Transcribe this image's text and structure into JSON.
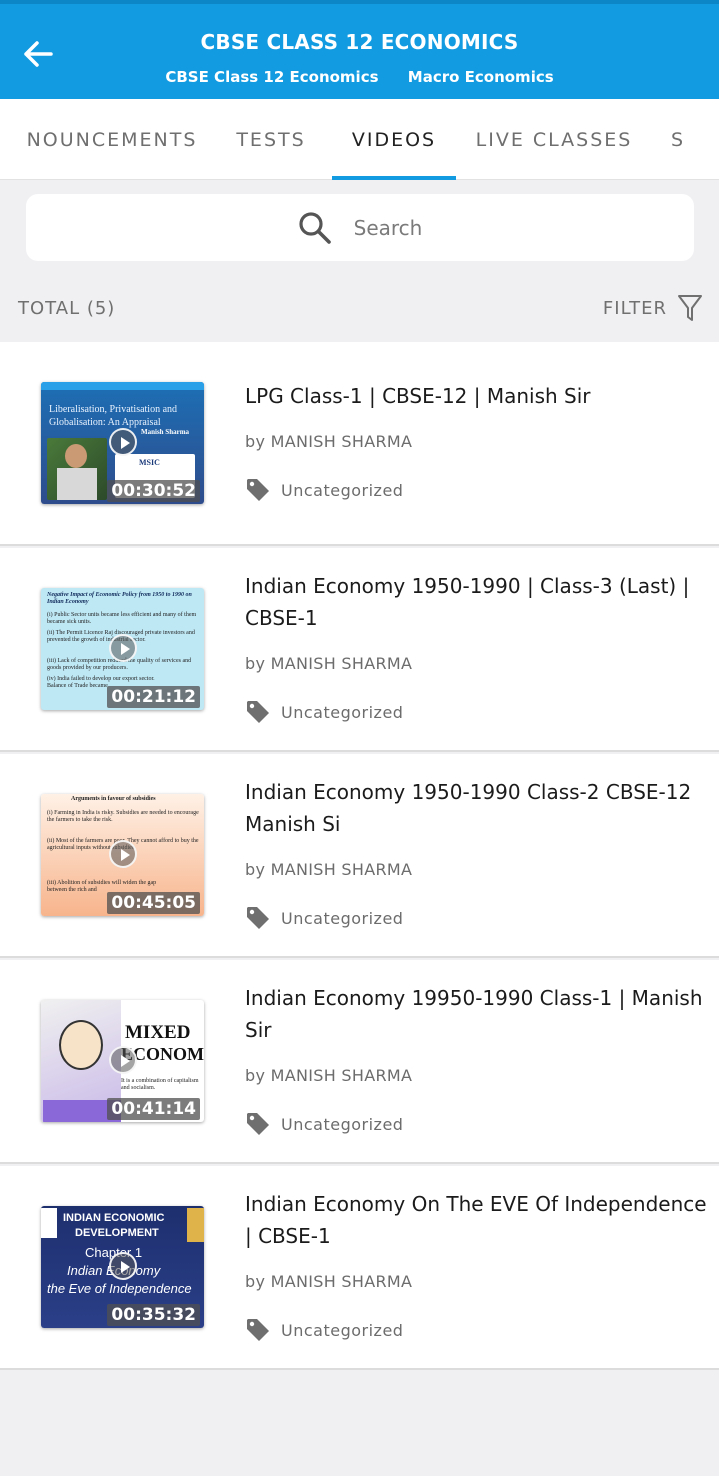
{
  "colors": {
    "header": "#129be0",
    "accent": "#129be0"
  },
  "header": {
    "title": "CBSE CLASS 12 ECONOMICS",
    "subtitle_left": "CBSE Class 12 Economics",
    "subtitle_right": "Macro Economics"
  },
  "tabs": [
    {
      "label": "NOUNCEMENTS"
    },
    {
      "label": "TESTS"
    },
    {
      "label": "VIDEOS"
    },
    {
      "label": "LIVE CLASSES"
    },
    {
      "label": "S"
    }
  ],
  "active_tab": "VIDEOS",
  "search": {
    "placeholder": "Search"
  },
  "total_label": "TOTAL (5)",
  "filter_label": "FILTER",
  "videos": [
    {
      "title": "LPG Class-1 | CBSE-12 | Manish Sir",
      "author": "by MANISH SHARMA",
      "category": "Uncategorized",
      "duration": "00:30:52",
      "thumb": {
        "l1": "Liberalisation, Privatisation and",
        "l2": "Globalisation: An Appraisal",
        "l3": "Manish Sharma",
        "l4": "MSIC"
      }
    },
    {
      "title": "Indian Economy 1950-1990 | Class-3 (Last) | CBSE-1",
      "author": "by MANISH SHARMA",
      "category": "Uncategorized",
      "duration": "00:21:12",
      "thumb": {
        "heading": "Negative Impact of Economic Policy from 1950 to 1990 on Indian Economy",
        "l1": "(i) Public Sector units became less efficient and many of them became sick units.",
        "l2": "(ii) The Permit Licence Raj discouraged private investors and prevented the growth of industrial sector.",
        "l3": "(iii) Lack of competition reduced the quality of services and goods provided by our producers.",
        "l4": "(iv) India failed to develop our export sector. Balance of Trade became"
      }
    },
    {
      "title": "Indian Economy 1950-1990 Class-2 CBSE-12 Manish Si",
      "author": "by MANISH SHARMA",
      "category": "Uncategorized",
      "duration": "00:45:05",
      "thumb": {
        "heading": "Arguments in favour of subsidies",
        "l1": "(i) Farming in India is risky. Subsidies are needed to encourage the farmers to take the risk.",
        "l2": "(ii) Most of the farmers are poor. They cannot afford to buy the agricultural inputs without subsidies.",
        "l3": "(iii) Abolition of subsidies will widen the gap between the rich and"
      }
    },
    {
      "title": "Indian Economy 19950-1990 Class-1 | Manish Sir",
      "author": "by MANISH SHARMA",
      "category": "Uncategorized",
      "duration": "00:41:14",
      "thumb": {
        "l1": "MIXED",
        "l2": "ECONOMY",
        "l3": "It is a combination of capitalism and socialism."
      }
    },
    {
      "title": "Indian Economy On The EVE Of Independence | CBSE-1",
      "author": "by MANISH SHARMA",
      "category": "Uncategorized",
      "duration": "00:35:32",
      "thumb": {
        "l1": "INDIAN ECONOMIC",
        "l2": "DEVELOPMENT",
        "l3": "Chapter 1",
        "l4": "Indian Economy",
        "l5": "the Eve of Independence"
      }
    }
  ]
}
